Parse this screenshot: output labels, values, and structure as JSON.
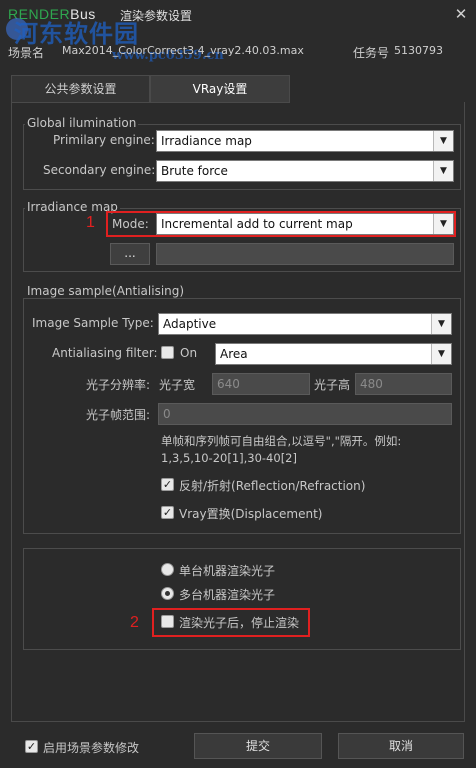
{
  "window": {
    "brand_render": "RENDER",
    "brand_bus": "Bus",
    "title": "渲染参数设置",
    "close_glyph": "✕"
  },
  "watermark": {
    "text": "河东软件园",
    "url": "www.pc0359.cn"
  },
  "info": {
    "scene_label": "场景名",
    "scene_name": "Max2014_ColorCorrect3.4_vray2.40.03.max",
    "task_label": "任务号",
    "task_no": "5130793"
  },
  "tabs": [
    {
      "label": "公共参数设置",
      "active": false
    },
    {
      "label": "VRay设置",
      "active": true
    }
  ],
  "global_illumination": {
    "title": "Global ilumination",
    "primary_label": "Primilary engine:",
    "primary_value": "Irradiance map",
    "secondary_label": "Secondary engine:",
    "secondary_value": "Brute force"
  },
  "irradiance_map": {
    "title": "Irradiance map",
    "marker": "1",
    "mode_label": "Mode:",
    "mode_value": "Incremental add to current map",
    "browse_label": "...",
    "path_value": ""
  },
  "image_sample": {
    "title": "Image sample(Antialising)",
    "type_label": "Image Sample Type:",
    "type_value": "Adaptive",
    "aa_label": "Antialiasing filter:",
    "aa_on_label": "On",
    "aa_on_checked": false,
    "aa_filter_value": "Area",
    "res_label": "光子分辨率:",
    "width_label": "光子宽",
    "width_value": "640",
    "height_label": "光子高",
    "height_value": "480",
    "frame_label": "光子帧范围:",
    "frame_value": "0",
    "hint_line1": "单帧和序列帧可自由组合,以逗号\",\"隔开。例如:",
    "hint_line2": "1,3,5,10-20[1],30-40[2]",
    "reflection_label": "反射/折射(Reflection/Refraction)",
    "reflection_checked": true,
    "displacement_label": "Vray置换(Displacement)",
    "displacement_checked": true
  },
  "photon": {
    "single_label": "单台机器渲染光子",
    "single_selected": false,
    "multi_label": "多台机器渲染光子",
    "multi_selected": true,
    "marker": "2",
    "stop_label": "渲染光子后，停止渲染",
    "stop_checked": false
  },
  "footer": {
    "enable_label": "启用场景参数修改",
    "enable_checked": true,
    "submit_label": "提交",
    "cancel_label": "取消"
  },
  "colors": {
    "background": "#2b2b2b",
    "highlight_red": "#e02020",
    "brand_green": "#2fa84f",
    "watermark_blue": "#1f5fbf"
  }
}
